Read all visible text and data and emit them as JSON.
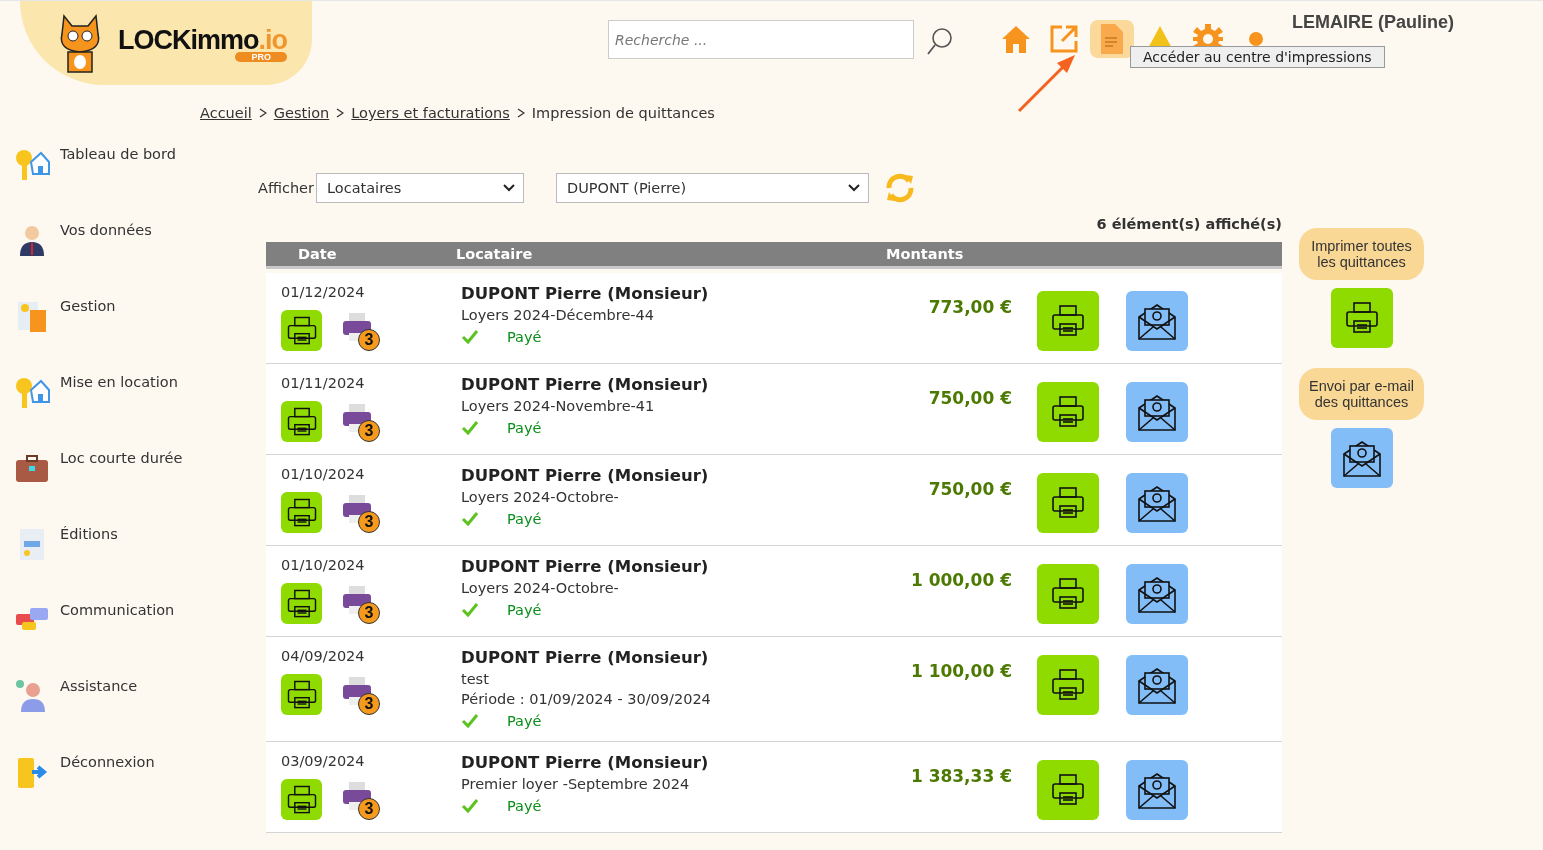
{
  "header": {
    "logo": {
      "name": "LOCKimmo",
      "suffix": ".io",
      "badge": "PRO"
    },
    "search": {
      "placeholder": "Recherche ..."
    },
    "toolbar": [
      {
        "kind": "home",
        "selected": false
      },
      {
        "kind": "external",
        "selected": false
      },
      {
        "kind": "print-center",
        "selected": true
      },
      {
        "kind": "alert",
        "selected": false
      },
      {
        "kind": "settings",
        "selected": false
      },
      {
        "kind": "dot",
        "selected": false
      }
    ],
    "user": "LEMAIRE (Pauline)",
    "tooltip": "Accéder au centre d'impressions"
  },
  "breadcrumb": [
    {
      "label": "Accueil",
      "link": true
    },
    {
      "label": "Gestion",
      "link": true
    },
    {
      "label": "Loyers et facturations",
      "link": true
    },
    {
      "label": "Impression de quittances",
      "link": false
    }
  ],
  "sidebar": {
    "items": [
      {
        "label": "Tableau de bord",
        "kind": "keyhouse"
      },
      {
        "label": "Vos données",
        "kind": "person"
      },
      {
        "label": "Gestion",
        "kind": "calculator"
      },
      {
        "label": "Mise en location",
        "kind": "keyhouse"
      },
      {
        "label": "Loc courte durée",
        "kind": "suitcase"
      },
      {
        "label": "Éditions",
        "kind": "report"
      },
      {
        "label": "Communication",
        "kind": "chat"
      },
      {
        "label": "Assistance",
        "kind": "support"
      },
      {
        "label": "Déconnexion",
        "kind": "exit"
      }
    ]
  },
  "filter": {
    "label": "Afficher",
    "type_value": "Locataires",
    "tenant_value": "DUPONT (Pierre)"
  },
  "count": "6 élément(s) affiché(s)",
  "table": {
    "columns": [
      "Date",
      "Locataire",
      "Montants"
    ],
    "rows": [
      {
        "date": "01/12/2024",
        "tenant": "DUPONT Pierre (Monsieur)",
        "lines": [
          "Loyers 2024-Décembre-44"
        ],
        "paid": true,
        "status": "Payé",
        "amount": "773,00 €",
        "copies": "3"
      },
      {
        "date": "01/11/2024",
        "tenant": "DUPONT Pierre (Monsieur)",
        "lines": [
          "Loyers 2024-Novembre-41"
        ],
        "paid": true,
        "status": "Payé",
        "amount": "750,00 €",
        "copies": "3"
      },
      {
        "date": "01/10/2024",
        "tenant": "DUPONT Pierre (Monsieur)",
        "lines": [
          "Loyers 2024-Octobre-"
        ],
        "paid": true,
        "status": "Payé",
        "amount": "750,00 €",
        "copies": "3"
      },
      {
        "date": "01/10/2024",
        "tenant": "DUPONT Pierre (Monsieur)",
        "lines": [
          "Loyers 2024-Octobre-"
        ],
        "paid": true,
        "status": "Payé",
        "amount": "1 000,00 €",
        "copies": "3"
      },
      {
        "date": "04/09/2024",
        "tenant": "DUPONT Pierre (Monsieur)",
        "lines": [
          "test",
          "Période : 01/09/2024 - 30/09/2024"
        ],
        "paid": true,
        "status": "Payé",
        "amount": "1 100,00 €",
        "copies": "3"
      },
      {
        "date": "03/09/2024",
        "tenant": "DUPONT Pierre (Monsieur)",
        "lines": [
          "Premier loyer -Septembre 2024"
        ],
        "paid": true,
        "status": "Payé",
        "amount": "1 383,33 €",
        "copies": "3"
      }
    ]
  },
  "side_actions": [
    {
      "label": "Imprimer toutes les quittances",
      "kind": "print"
    },
    {
      "label": "Envoi par e-mail des quittances",
      "kind": "email"
    }
  ]
}
